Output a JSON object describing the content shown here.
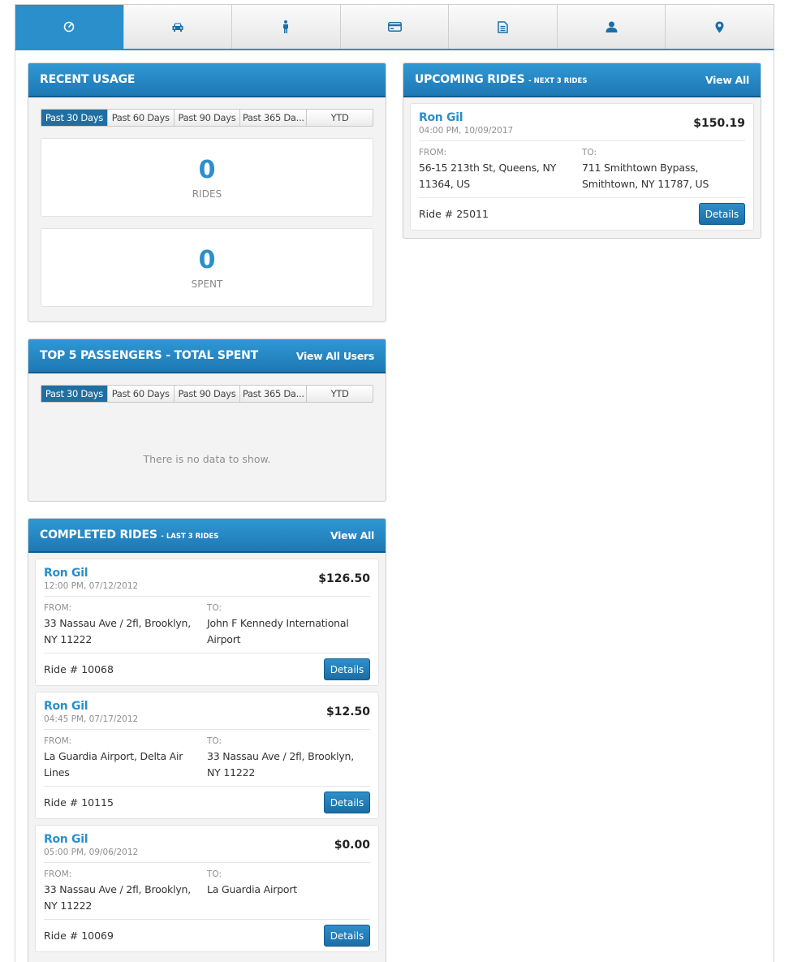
{
  "nav": {
    "tabs": [
      {
        "icon": "dashboard-icon",
        "active": true
      },
      {
        "icon": "car-icon",
        "active": false
      },
      {
        "icon": "passenger-icon",
        "active": false
      },
      {
        "icon": "credit-card-icon",
        "active": false
      },
      {
        "icon": "document-icon",
        "active": false
      },
      {
        "icon": "user-icon",
        "active": false
      },
      {
        "icon": "location-pin-icon",
        "active": false
      }
    ]
  },
  "recent_usage": {
    "title": "RECENT USAGE",
    "periods": [
      "Past 30 Days",
      "Past 60 Days",
      "Past 90 Days",
      "Past 365 Da...",
      "YTD"
    ],
    "active_period": "Past 30 Days",
    "rides": {
      "value": "0",
      "label": "RIDES"
    },
    "spent": {
      "value": "0",
      "label": "SPENT"
    }
  },
  "top_passengers": {
    "title": "TOP 5 PASSENGERS - TOTAL SPENT",
    "link": "View All Users",
    "periods": [
      "Past 30 Days",
      "Past 60 Days",
      "Past 90 Days",
      "Past 365 Da...",
      "YTD"
    ],
    "active_period": "Past 30 Days",
    "empty_message": "There is no data to show."
  },
  "completed_rides": {
    "title": "COMPLETED RIDES",
    "subtitle": "- LAST 3 RIDES",
    "link": "View All",
    "from_label": "FROM:",
    "to_label": "TO:",
    "details_label": "Details",
    "rides": [
      {
        "name": "Ron Gil",
        "time": "12:00 PM, 07/12/2012",
        "price": "$126.50",
        "from": "33 Nassau Ave / 2fl, Brooklyn, NY 11222",
        "to": "John F Kennedy International Airport",
        "ride_no": "Ride # 10068"
      },
      {
        "name": "Ron Gil",
        "time": "04:45 PM, 07/17/2012",
        "price": "$12.50",
        "from": "La Guardia Airport, Delta Air Lines",
        "to": "33 Nassau Ave / 2fl, Brooklyn, NY 11222",
        "ride_no": "Ride # 10115"
      },
      {
        "name": "Ron Gil",
        "time": "05:00 PM, 09/06/2012",
        "price": "$0.00",
        "from": "33 Nassau Ave / 2fl, Brooklyn, NY 11222",
        "to": "La Guardia Airport",
        "ride_no": "Ride # 10069"
      }
    ]
  },
  "upcoming_rides": {
    "title": "UPCOMING RIDES",
    "subtitle": "- NEXT 3 RIDES",
    "link": "View All",
    "from_label": "FROM:",
    "to_label": "TO:",
    "details_label": "Details",
    "rides": [
      {
        "name": "Ron Gil",
        "time": "04:00 PM, 10/09/2017",
        "price": "$150.19",
        "from": "56-15 213th St, Queens, NY 11364, US",
        "to": "711 Smithtown Bypass, Smithtown, NY 11787, US",
        "ride_no": "Ride # 25011"
      }
    ]
  },
  "colors": {
    "accent": "#2a8fcb",
    "header_dark": "#1e78b4",
    "active_period": "#1f6fa3"
  }
}
